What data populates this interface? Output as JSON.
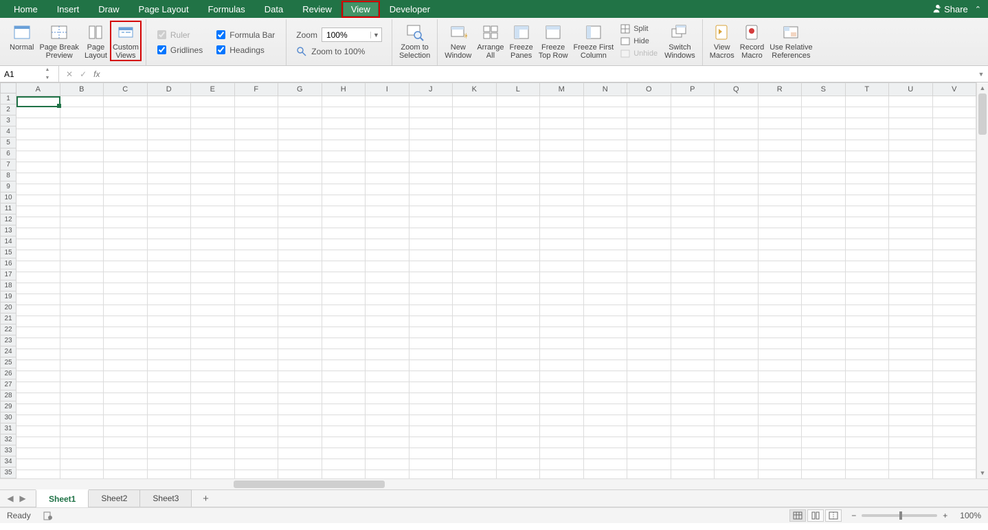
{
  "menubar": {
    "tabs": [
      "Home",
      "Insert",
      "Draw",
      "Page Layout",
      "Formulas",
      "Data",
      "Review",
      "View",
      "Developer"
    ],
    "active_index": 7,
    "share_label": "Share"
  },
  "ribbon": {
    "views": {
      "normal": "Normal",
      "page_break1": "Page Break",
      "page_break2": "Preview",
      "page_layout1": "Page",
      "page_layout2": "Layout",
      "custom1": "Custom",
      "custom2": "Views"
    },
    "show": {
      "ruler": "Ruler",
      "formula_bar": "Formula Bar",
      "gridlines": "Gridlines",
      "headings": "Headings"
    },
    "zoom": {
      "label": "Zoom",
      "value": "100%",
      "to100": "Zoom to 100%",
      "to_selection1": "Zoom to",
      "to_selection2": "Selection"
    },
    "window": {
      "new1": "New",
      "new2": "Window",
      "arrange1": "Arrange",
      "arrange2": "All",
      "freeze1": "Freeze",
      "freeze2": "Panes",
      "freeze_top1": "Freeze",
      "freeze_top2": "Top Row",
      "freeze_first1": "Freeze First",
      "freeze_first2": "Column",
      "split": "Split",
      "hide": "Hide",
      "unhide": "Unhide",
      "switch1": "Switch",
      "switch2": "Windows"
    },
    "macros": {
      "view1": "View",
      "view2": "Macros",
      "record1": "Record",
      "record2": "Macro",
      "relative1": "Use Relative",
      "relative2": "References"
    }
  },
  "formula_bar": {
    "namebox": "A1",
    "fx": "fx"
  },
  "grid": {
    "columns": [
      "A",
      "B",
      "C",
      "D",
      "E",
      "F",
      "G",
      "H",
      "I",
      "J",
      "K",
      "L",
      "M",
      "N",
      "O",
      "P",
      "Q",
      "R",
      "S",
      "T",
      "U",
      "V"
    ],
    "row_count": 35,
    "selected_cell": "A1"
  },
  "sheets": {
    "tabs": [
      "Sheet1",
      "Sheet2",
      "Sheet3"
    ],
    "active_index": 0
  },
  "status": {
    "ready": "Ready",
    "zoom": "100%"
  }
}
